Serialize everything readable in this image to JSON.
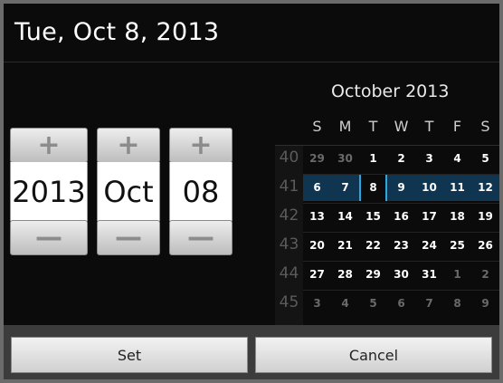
{
  "header": {
    "title": "Tue, Oct 8, 2013"
  },
  "spinners": {
    "year": {
      "plus": "+",
      "value": "2013",
      "minus": "—"
    },
    "month": {
      "plus": "+",
      "value": "Oct",
      "minus": "—"
    },
    "day": {
      "plus": "+",
      "value": "08",
      "minus": "—"
    }
  },
  "calendar": {
    "title": "October 2013",
    "weekdays": [
      "S",
      "M",
      "T",
      "W",
      "T",
      "F",
      "S"
    ],
    "week_numbers": [
      "40",
      "41",
      "42",
      "43",
      "44",
      "45"
    ],
    "weeks": [
      [
        "29",
        "30",
        "1",
        "2",
        "3",
        "4",
        "5"
      ],
      [
        "6",
        "7",
        "8",
        "9",
        "10",
        "11",
        "12"
      ],
      [
        "13",
        "14",
        "15",
        "16",
        "17",
        "18",
        "19"
      ],
      [
        "20",
        "21",
        "22",
        "23",
        "24",
        "25",
        "26"
      ],
      [
        "27",
        "28",
        "29",
        "30",
        "31",
        "1",
        "2"
      ],
      [
        "3",
        "4",
        "5",
        "6",
        "7",
        "8",
        "9"
      ]
    ],
    "dim_days": [
      [
        0,
        0
      ],
      [
        0,
        1
      ],
      [
        4,
        5
      ],
      [
        4,
        6
      ],
      [
        5,
        0
      ],
      [
        5,
        1
      ],
      [
        5,
        2
      ],
      [
        5,
        3
      ],
      [
        5,
        4
      ],
      [
        5,
        5
      ],
      [
        5,
        6
      ]
    ],
    "selected_week_index": 1,
    "selected_day": {
      "week": 1,
      "col": 2
    },
    "colors": {
      "selected_week": "#0f3550",
      "selected_day_border": "#29a9e0"
    }
  },
  "footer": {
    "set_label": "Set",
    "cancel_label": "Cancel"
  }
}
